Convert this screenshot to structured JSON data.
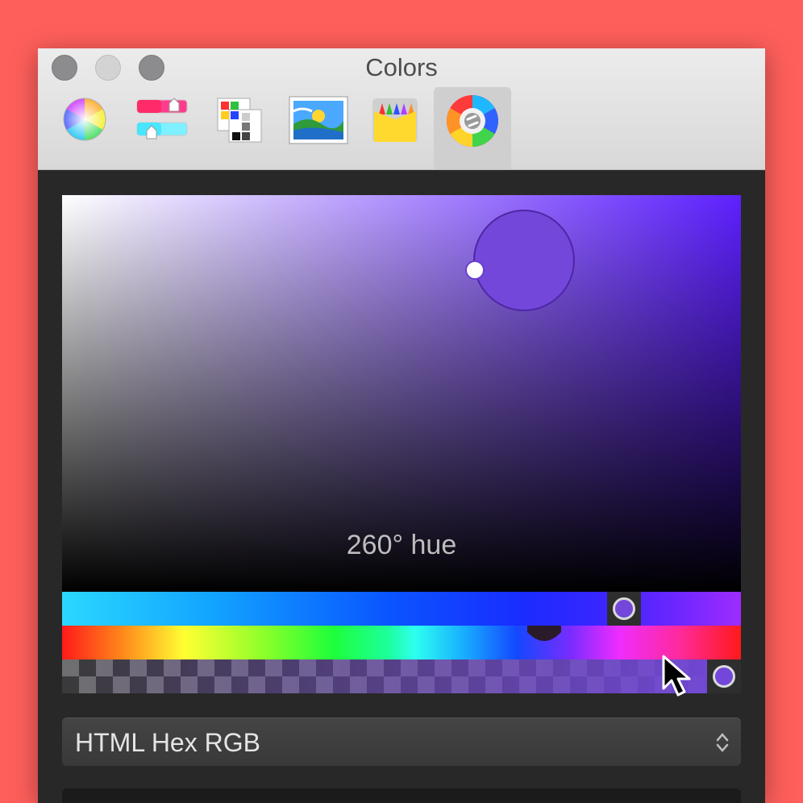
{
  "window": {
    "title": "Colors"
  },
  "toolbar": {
    "tabs": [
      {
        "icon": "color-wheel-icon"
      },
      {
        "icon": "color-sliders-icon"
      },
      {
        "icon": "color-palettes-icon"
      },
      {
        "icon": "image-palettes-icon"
      },
      {
        "icon": "pencils-icon"
      },
      {
        "icon": "skala-color-icon",
        "selected": true
      }
    ]
  },
  "picker": {
    "hue_label": "260° hue",
    "selected_color": "#7247d9",
    "hue_degrees": 260
  },
  "format_select": {
    "label": "HTML Hex RGB"
  },
  "colors": {
    "background": "#fe5f5b",
    "panel": "#282828",
    "accent": "#5e20ff"
  }
}
